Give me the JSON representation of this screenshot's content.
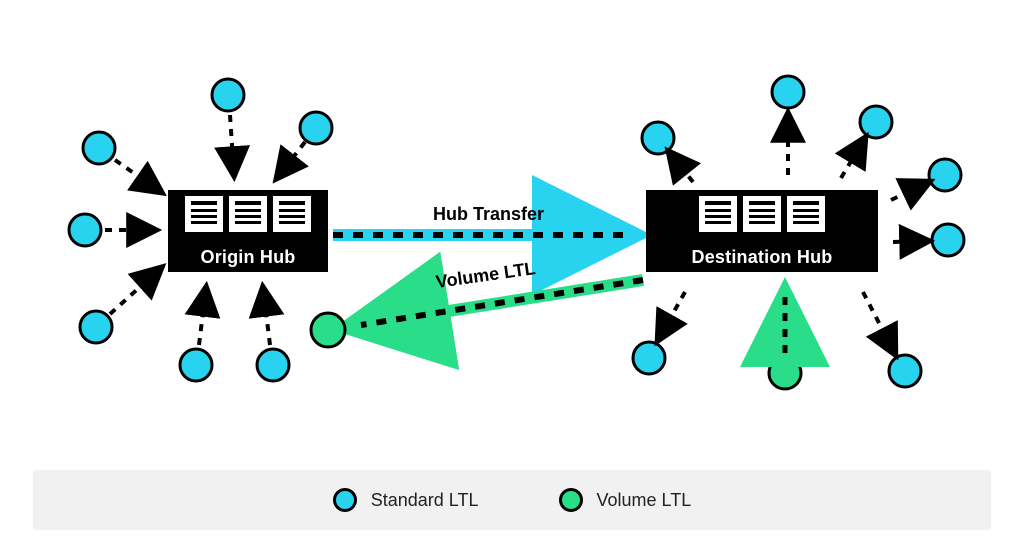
{
  "colors": {
    "standard": "#28d3ef",
    "volume": "#29dd89",
    "black": "#000000",
    "legend_bg": "#f1f1f1"
  },
  "hubs": {
    "origin": {
      "label": "Origin Hub"
    },
    "destination": {
      "label": "Destination Hub"
    }
  },
  "flows": {
    "hub_transfer": {
      "label": "Hub Transfer"
    },
    "volume_ltl": {
      "label": "Volume LTL"
    }
  },
  "legend": {
    "standard": "Standard LTL",
    "volume": "Volume LTL"
  }
}
